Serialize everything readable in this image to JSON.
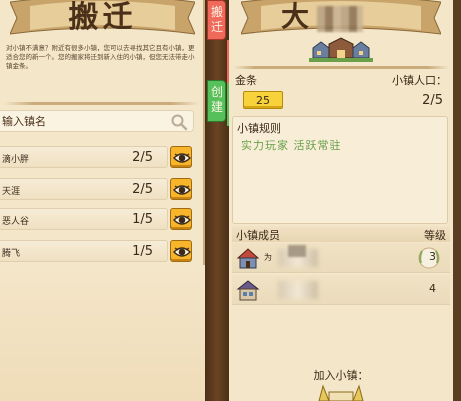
{
  "left_panel": {
    "title": "搬迁",
    "description": "对小镇不满意？附近有很多小镇，您可以去寻找其它且有小镇，更适合您的新一个。您的搬家将迁到新入住的小镇，但您无法带走小镇金条。",
    "search": {
      "placeholder": "输入镇名",
      "icon": "search-icon"
    },
    "towns": [
      {
        "name": "滴小胖",
        "count": "2/5",
        "icon": "eye-icon"
      },
      {
        "name": "天涯",
        "count": "2/5",
        "icon": "eye-icon"
      },
      {
        "name": "恶人谷",
        "count": "1/5",
        "icon": "eye-icon"
      },
      {
        "name": "腾飞",
        "count": "1/5",
        "icon": "eye-icon"
      }
    ]
  },
  "tabs": {
    "move": "搬迁",
    "create": "创建"
  },
  "right_panel": {
    "title": "大",
    "gold_label": "金条",
    "gold_value": "25",
    "population_label": "小镇人口：",
    "population_value": "2/5",
    "rules_label": "小镇规则",
    "rules_text": "实力玩家  活跃常驻",
    "members_label": "小镇成员",
    "level_label": "等级",
    "members": [
      {
        "name": "为",
        "level": "3"
      },
      {
        "name": "",
        "level": "4"
      }
    ],
    "join_label": "加入小镇："
  },
  "colors": {
    "parchment": "#f4e6c9",
    "tab_move": "#ef6a5a",
    "tab_create": "#56c15a",
    "gold": "#f7d23a",
    "eye_button": "#f6b52a",
    "rules_text": "#6aa04a"
  }
}
